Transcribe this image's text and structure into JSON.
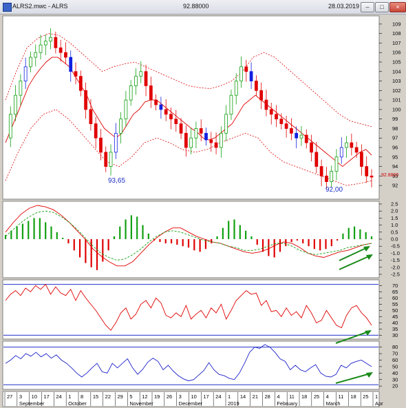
{
  "window": {
    "title_left": "ALRS2.mwc - ALRS",
    "title_price": "92.88000",
    "title_date": "28.03.2019",
    "buttons": [
      "minimize-button",
      "maximize-button",
      "close-button"
    ]
  },
  "colors": {
    "up": "#10a010",
    "down": "#e00000",
    "up_body": "#10a010",
    "down_body": "#e00000",
    "blue_candle": "#1020e0",
    "ma": "#e00000",
    "band": "#e00000",
    "rsi": "#e00000",
    "stoch": "#1a20c8",
    "guide": "#2030c8",
    "arrow": "#1a8a1a",
    "accent_text": "#1d2fc8",
    "current_price": "#d00000"
  },
  "panels": {
    "price": {
      "y_ticks": [
        109,
        108,
        107,
        106,
        105,
        104,
        103,
        102,
        101,
        100,
        99,
        98,
        97,
        96,
        95,
        94,
        93,
        92
      ],
      "current_price_label": "92.8800",
      "annotations": [
        {
          "text": "93,65"
        },
        {
          "text": "92,00"
        }
      ]
    },
    "macd": {
      "y_ticks": [
        "2.5",
        "2.0",
        "1.5",
        "1.0",
        "0.5",
        "0.0",
        "-0.5",
        "-1.0",
        "-1.5",
        "-2.0",
        "-2.5"
      ]
    },
    "rsi": {
      "y_ticks": [
        70,
        65,
        60,
        55,
        50,
        45,
        40,
        35,
        30
      ]
    },
    "stoch": {
      "y_ticks": [
        80,
        70,
        60,
        50,
        40,
        30,
        20
      ]
    }
  },
  "date_axis": {
    "day_labels": [
      "27",
      "3",
      "10",
      "17",
      "24",
      "1",
      "8",
      "15",
      "22",
      "29",
      "5",
      "12",
      "19",
      "26",
      "3",
      "10",
      "17",
      "24",
      "1",
      "14",
      "21",
      "28",
      "4",
      "11",
      "18",
      "25",
      "4",
      "11",
      "18",
      "25",
      "1"
    ],
    "month_labels": [
      "September",
      "October",
      "November",
      "December",
      "2019",
      "February",
      "March",
      "Apr"
    ]
  },
  "chart_data": [
    {
      "type": "candlestick",
      "title": "",
      "symbol": "ALRS",
      "ylim": [
        91.5,
        109.5
      ],
      "current_price": 92.88,
      "annotated_lows": [
        93.65,
        92.0
      ],
      "close_path": [
        97.0,
        99.5,
        101.5,
        103.0,
        104.5,
        105.5,
        106.0,
        106.8,
        107.2,
        107.6,
        106.5,
        106.0,
        105.5,
        104.0,
        103.5,
        102.0,
        100.0,
        98.5,
        97.0,
        95.5,
        94.0,
        95.5,
        97.5,
        99.0,
        101.0,
        102.5,
        103.5,
        104.0,
        102.5,
        101.0,
        100.5,
        100.0,
        99.5,
        99.0,
        98.5,
        97.5,
        96.0,
        97.0,
        98.0,
        97.5,
        96.8,
        96.5,
        96.0,
        97.5,
        99.5,
        101.5,
        103.0,
        104.5,
        104.0,
        103.0,
        102.0,
        101.0,
        100.0,
        99.5,
        99.0,
        98.5,
        98.0,
        97.5,
        97.0,
        97.3,
        96.5,
        95.5,
        94.0,
        93.0,
        92.4,
        93.5,
        95.0,
        96.0,
        96.5,
        96.0,
        95.5,
        94.0,
        93.0,
        92.88
      ],
      "ma_path": [
        96.5,
        98.0,
        99.5,
        101.0,
        102.5,
        103.5,
        104.3,
        105.0,
        105.5,
        105.5,
        105.0,
        104.5,
        103.5,
        102.5,
        101.5,
        100.0,
        99.0,
        98.0,
        97.5,
        97.0,
        97.5,
        98.5,
        99.5,
        100.0,
        100.8,
        101.0,
        101.0,
        100.5,
        100.0,
        99.5,
        99.0,
        98.5,
        98.0,
        97.6,
        97.0,
        96.8,
        97.0,
        97.5,
        98.0,
        98.5,
        99.5,
        100.5,
        101.0,
        101.5,
        101.0,
        100.5,
        100.0,
        99.5,
        99.0,
        98.5,
        98.0,
        97.5,
        97.0,
        96.5,
        96.0,
        95.5,
        95.0,
        94.5,
        94.0,
        94.5,
        95.0,
        95.5,
        95.8,
        95.2
      ],
      "upper_band": [
        101.0,
        104.0,
        106.5,
        107.5,
        108.0,
        107.8,
        107.0,
        106.0,
        105.0,
        104.0,
        104.5,
        104.8,
        105.0,
        104.5,
        104.0,
        103.5,
        103.0,
        102.5,
        102.3,
        102.2,
        102.5,
        103.0,
        104.0,
        105.5,
        106.0,
        105.5,
        104.5,
        103.5,
        102.5,
        101.5,
        100.5,
        99.5,
        98.8,
        98.5,
        98.2
      ],
      "lower_band": [
        92.5,
        95.5,
        98.0,
        99.5,
        100.0,
        99.0,
        97.5,
        96.0,
        94.5,
        94.0,
        95.0,
        96.5,
        97.0,
        96.5,
        95.8,
        95.5,
        95.8,
        96.5,
        97.0,
        97.5,
        97.0,
        95.5,
        94.5,
        94.0,
        93.5,
        93.0,
        92.5,
        92.0,
        92.2,
        92.5
      ]
    },
    {
      "type": "bar",
      "title": "",
      "ylim": [
        -2.5,
        2.5
      ],
      "histogram": [
        0.3,
        0.6,
        0.9,
        1.1,
        1.3,
        1.5,
        1.5,
        1.2,
        0.9,
        0.5,
        0.1,
        -0.3,
        -0.8,
        -1.3,
        -1.7,
        -2.0,
        -2.2,
        -1.6,
        -0.8,
        0.2,
        0.9,
        1.4,
        1.7,
        1.6,
        1.0,
        0.4,
        -0.1,
        -0.2,
        -0.3,
        -0.3,
        -0.4,
        -0.5,
        -0.6,
        -0.8,
        -0.9,
        -0.7,
        -0.3,
        0.2,
        0.8,
        1.3,
        1.4,
        1.0,
        0.6,
        0.2,
        -0.4,
        -0.9,
        -1.2,
        -1.3,
        -0.9,
        -0.5,
        -0.2,
        -0.1,
        -0.3,
        -0.5,
        -0.7,
        -0.8,
        -0.7,
        -0.5,
        -0.1,
        0.4,
        0.8,
        0.9,
        0.7,
        0.5,
        0.2
      ],
      "macd_line": [
        0.5,
        1.2,
        1.8,
        2.2,
        2.4,
        2.3,
        2.1,
        1.7,
        1.2,
        0.6,
        0.0,
        -0.7,
        -1.2,
        -1.6,
        -1.9,
        -1.9,
        -1.6,
        -1.0,
        -0.4,
        0.1,
        0.5,
        0.8,
        0.8,
        0.5,
        0.2,
        0.0,
        -0.2,
        -0.3,
        -0.5,
        -0.7,
        -0.9,
        -1.0,
        -0.9,
        -0.7,
        -0.4,
        -0.2,
        -0.3,
        -0.6,
        -1.0,
        -1.2,
        -1.3,
        -1.1,
        -0.9,
        -0.8,
        -0.6,
        -0.4,
        -0.3
      ],
      "signal_line": [
        0.2,
        0.7,
        1.2,
        1.6,
        1.9,
        2.0,
        1.9,
        1.6,
        1.2,
        0.7,
        0.1,
        -0.5,
        -1.0,
        -1.3,
        -1.5,
        -1.4,
        -1.1,
        -0.7,
        -0.2,
        0.2,
        0.5,
        0.6,
        0.5,
        0.3,
        0.1,
        -0.1,
        -0.2,
        -0.3,
        -0.5,
        -0.6,
        -0.8,
        -0.8,
        -0.7,
        -0.5,
        -0.3,
        -0.3,
        -0.5,
        -0.8,
        -1.0,
        -1.1,
        -1.0,
        -0.9,
        -0.8,
        -0.6,
        -0.5,
        -0.4,
        -0.3
      ]
    },
    {
      "type": "line",
      "title": "",
      "ylim": [
        28,
        73
      ],
      "guides": [
        71,
        30
      ],
      "values": [
        58,
        63,
        66,
        62,
        68,
        65,
        70,
        67,
        71,
        63,
        69,
        64,
        62,
        67,
        58,
        66,
        60,
        55,
        50,
        44,
        38,
        34,
        40,
        48,
        52,
        43,
        47,
        55,
        58,
        52,
        60,
        56,
        46,
        44,
        48,
        45,
        54,
        43,
        47,
        50,
        44,
        52,
        48,
        55,
        43,
        50,
        58,
        62,
        66,
        63,
        64,
        54,
        58,
        49,
        50,
        45,
        52,
        46,
        49,
        44,
        54,
        48,
        40,
        42,
        50,
        44,
        38,
        36,
        46,
        52,
        54,
        48,
        44,
        38
      ],
      "trend_arrow_direction": "up"
    },
    {
      "type": "line",
      "title": "",
      "ylim": [
        17,
        86
      ],
      "guides": [
        80,
        22
      ],
      "values": [
        55,
        60,
        67,
        62,
        70,
        66,
        72,
        65,
        70,
        63,
        68,
        60,
        55,
        48,
        40,
        34,
        40,
        48,
        55,
        42,
        40,
        55,
        48,
        55,
        62,
        48,
        38,
        46,
        57,
        63,
        58,
        45,
        52,
        43,
        36,
        31,
        28,
        30,
        37,
        44,
        56,
        45,
        38,
        36,
        32,
        30,
        40,
        55,
        72,
        80,
        78,
        84,
        80,
        72,
        62,
        58,
        45,
        52,
        45,
        42,
        48,
        53,
        40,
        35,
        34,
        38,
        52,
        48,
        55,
        58,
        60,
        55,
        50
      ],
      "trend_arrow_direction": "up"
    }
  ]
}
